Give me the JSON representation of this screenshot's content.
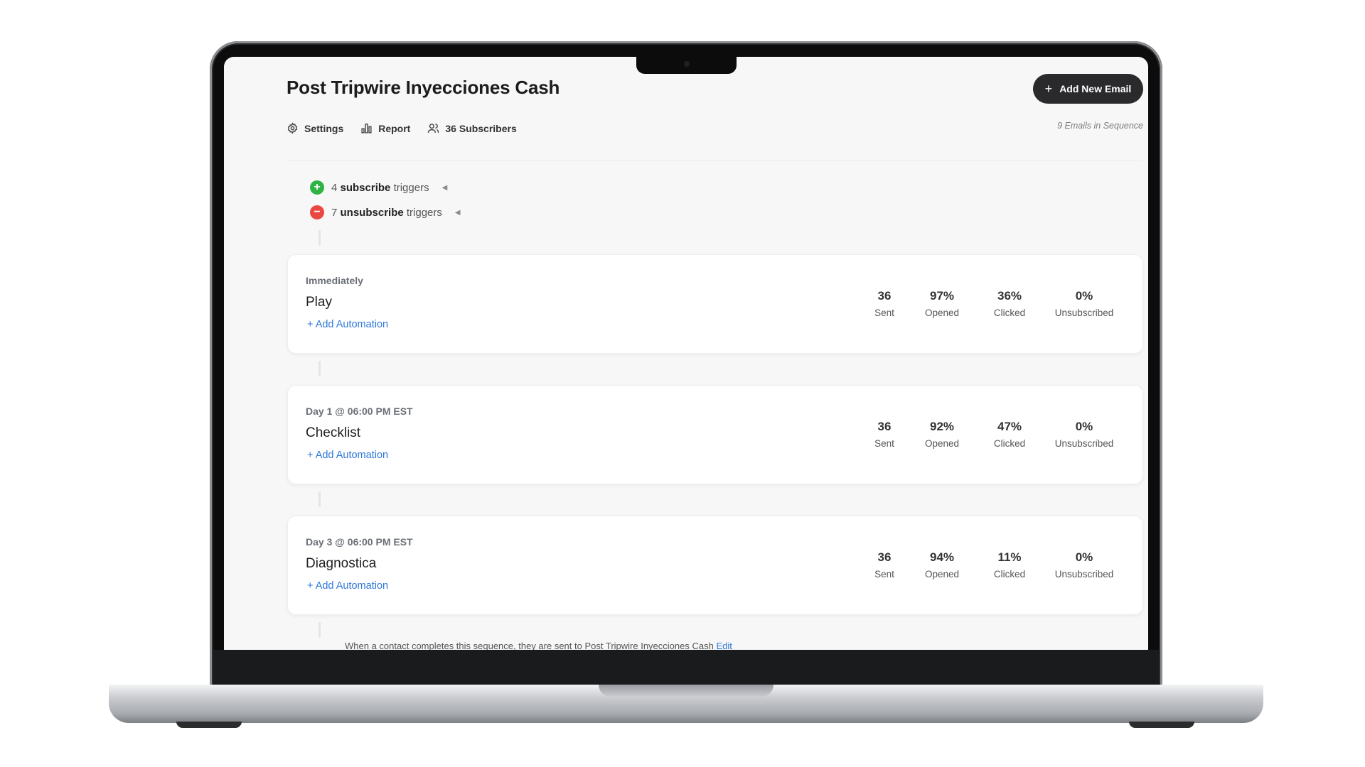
{
  "header": {
    "title": "Post Tripwire Inyecciones Cash",
    "add_button_icon": "plus-icon",
    "add_button_label": "Add New Email",
    "sequence_count": "9 Emails in Sequence"
  },
  "nav": {
    "settings": {
      "icon": "gear-icon",
      "label": "Settings"
    },
    "report": {
      "icon": "bar-chart-icon",
      "label": "Report"
    },
    "subscribers": {
      "icon": "users-icon",
      "label": "36 Subscribers"
    }
  },
  "triggers": {
    "subscribe": {
      "count": "4",
      "bold": "subscribe",
      "suffix": "triggers"
    },
    "unsubscribe": {
      "count": "7",
      "bold": "unsubscribe",
      "suffix": "triggers"
    }
  },
  "emails": [
    {
      "timing": "Immediately",
      "name": "Play",
      "automation_link": "+ Add Automation",
      "stats": [
        {
          "value": "36",
          "label": "Sent"
        },
        {
          "value": "97%",
          "label": "Opened"
        },
        {
          "value": "36%",
          "label": "Clicked"
        },
        {
          "value": "0%",
          "label": "Unsubscribed"
        }
      ]
    },
    {
      "timing": "Day 1 @ 06:00 PM EST",
      "name": "Checklist",
      "automation_link": "+ Add Automation",
      "stats": [
        {
          "value": "36",
          "label": "Sent"
        },
        {
          "value": "92%",
          "label": "Opened"
        },
        {
          "value": "47%",
          "label": "Clicked"
        },
        {
          "value": "0%",
          "label": "Unsubscribed"
        }
      ]
    },
    {
      "timing": "Day 3 @ 06:00 PM EST",
      "name": "Diagnostica",
      "automation_link": "+ Add Automation",
      "stats": [
        {
          "value": "36",
          "label": "Sent"
        },
        {
          "value": "94%",
          "label": "Opened"
        },
        {
          "value": "11%",
          "label": "Clicked"
        },
        {
          "value": "0%",
          "label": "Unsubscribed"
        }
      ]
    }
  ],
  "footer_note": {
    "text": "When a contact completes this sequence, they are sent to Post Tripwire Inyecciones Cash",
    "edit_label": "Edit"
  },
  "colors": {
    "accent_blue": "#2f79d9",
    "subscribe_green": "#2fb344",
    "unsubscribe_red": "#ea4743",
    "button_dark": "#2a2a2c"
  }
}
